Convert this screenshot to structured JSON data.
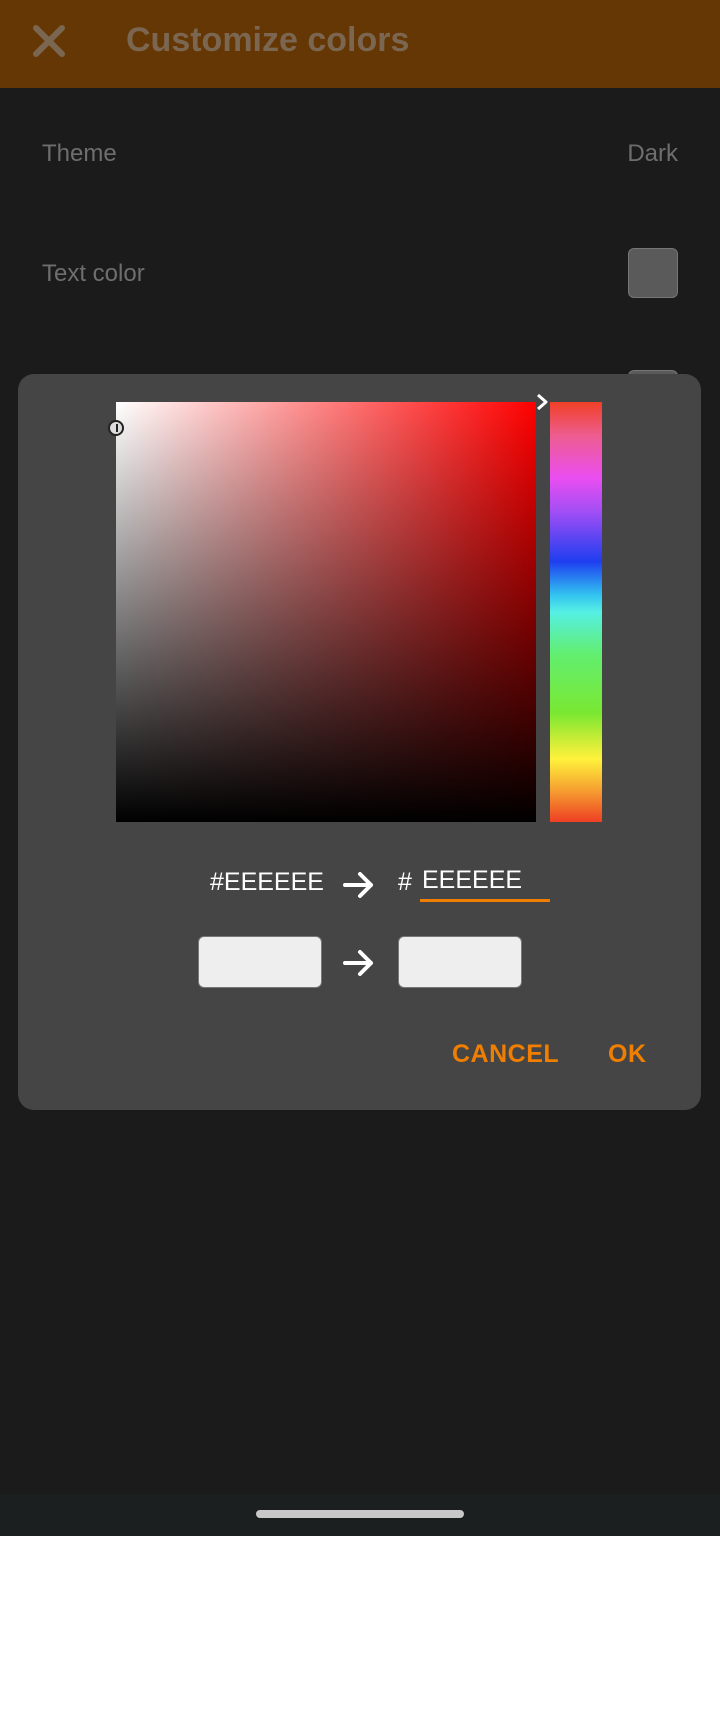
{
  "app_bar": {
    "title": "Customize colors",
    "close_icon": "close-icon",
    "background_color": "#653704"
  },
  "settings": {
    "theme_label": "Theme",
    "theme_value": "Dark",
    "text_color_label": "Text color",
    "text_color_swatch": "#5a5a5a"
  },
  "color_picker": {
    "old_hex": "#EEEEEE",
    "hash_prefix": "#",
    "new_hex_value": "EEEEEE",
    "old_swatch_color": "#EEEEEE",
    "new_swatch_color": "#EEEEEE",
    "hue": "#ff0000",
    "cancel_label": "CANCEL",
    "ok_label": "OK",
    "accent_color": "#f07e00"
  }
}
